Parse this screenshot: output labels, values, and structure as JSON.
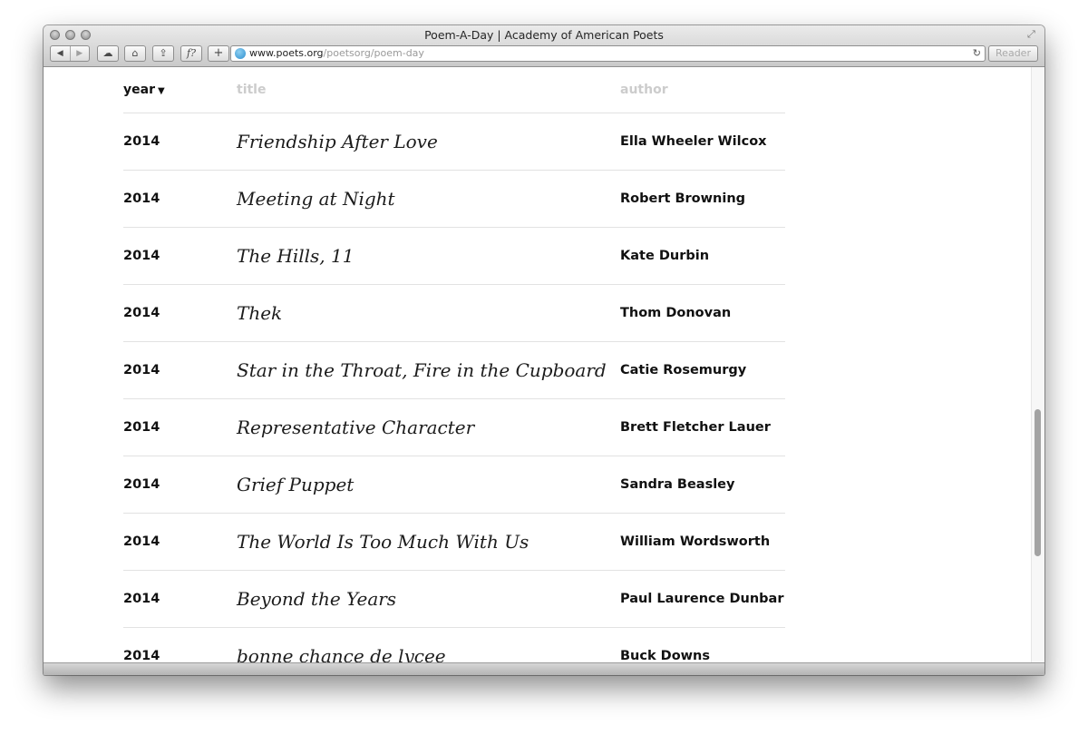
{
  "window": {
    "title": "Poem-A-Day | Academy of American Poets",
    "url_host": "www.poets.org",
    "url_path": "/poetsorg/poem-day",
    "reader_label": "Reader"
  },
  "toolbar": {
    "back_glyph": "◀",
    "forward_glyph": "▶",
    "cloud_glyph": "☁",
    "home_glyph": "⌂",
    "share_glyph": "⇪",
    "fx_glyph": "f?",
    "add_glyph": "+",
    "reload_glyph": "↻",
    "icons": [
      "back-icon",
      "forward-icon",
      "cloud-icon",
      "home-icon",
      "share-icon",
      "function-icon",
      "add-icon",
      "globe-icon",
      "reload-icon"
    ]
  },
  "table": {
    "headers": {
      "year": "year",
      "title": "title",
      "author": "author"
    },
    "sort_glyph": "▼",
    "rows": [
      {
        "year": "2014",
        "title": "Friendship After Love",
        "author": "Ella Wheeler Wilcox"
      },
      {
        "year": "2014",
        "title": "Meeting at Night",
        "author": "Robert Browning"
      },
      {
        "year": "2014",
        "title": "The Hills, 11",
        "author": "Kate Durbin"
      },
      {
        "year": "2014",
        "title": "Thek",
        "author": "Thom Donovan"
      },
      {
        "year": "2014",
        "title": "Star in the Throat, Fire in the Cupboard",
        "author": "Catie Rosemurgy"
      },
      {
        "year": "2014",
        "title": "Representative Character",
        "author": "Brett Fletcher Lauer"
      },
      {
        "year": "2014",
        "title": "Grief Puppet",
        "author": "Sandra Beasley"
      },
      {
        "year": "2014",
        "title": "The World Is Too Much With Us",
        "author": "William Wordsworth"
      },
      {
        "year": "2014",
        "title": "Beyond the Years",
        "author": "Paul Laurence Dunbar"
      },
      {
        "year": "2014",
        "title": "bonne chance de lycee",
        "author": "Buck Downs"
      }
    ]
  },
  "colors": {
    "header_muted": "#cccccc",
    "text": "#111111",
    "rule": "#e2e2e2"
  }
}
